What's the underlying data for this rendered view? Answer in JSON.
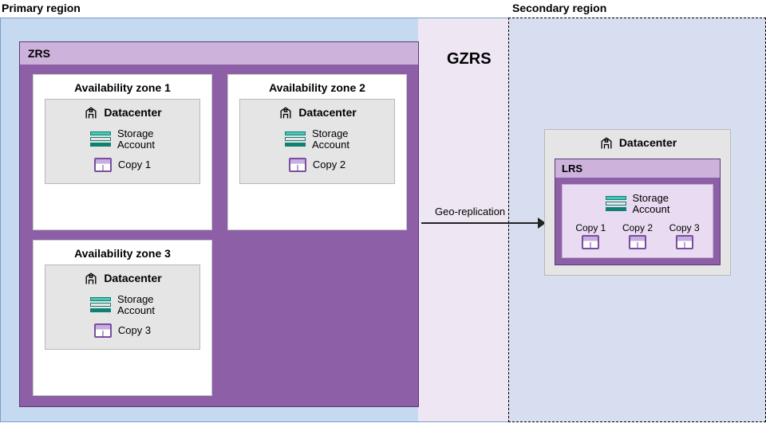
{
  "diagram_title": "GZRS",
  "regions": {
    "primary_label": "Primary region",
    "secondary_label": "Secondary region"
  },
  "zrs": {
    "label": "ZRS",
    "zones": [
      {
        "title": "Availability zone 1",
        "datacenter": "Datacenter",
        "storage": "Storage\nAccount",
        "copy": "Copy 1"
      },
      {
        "title": "Availability zone 2",
        "datacenter": "Datacenter",
        "storage": "Storage\nAccount",
        "copy": "Copy 2"
      },
      {
        "title": "Availability zone 3",
        "datacenter": "Datacenter",
        "storage": "Storage\nAccount",
        "copy": "Copy 3"
      }
    ]
  },
  "lrs": {
    "datacenter": "Datacenter",
    "label": "LRS",
    "storage": "Storage\nAccount",
    "copies": [
      "Copy 1",
      "Copy 2",
      "Copy 3"
    ]
  },
  "arrow": {
    "label": "Geo-replication"
  }
}
